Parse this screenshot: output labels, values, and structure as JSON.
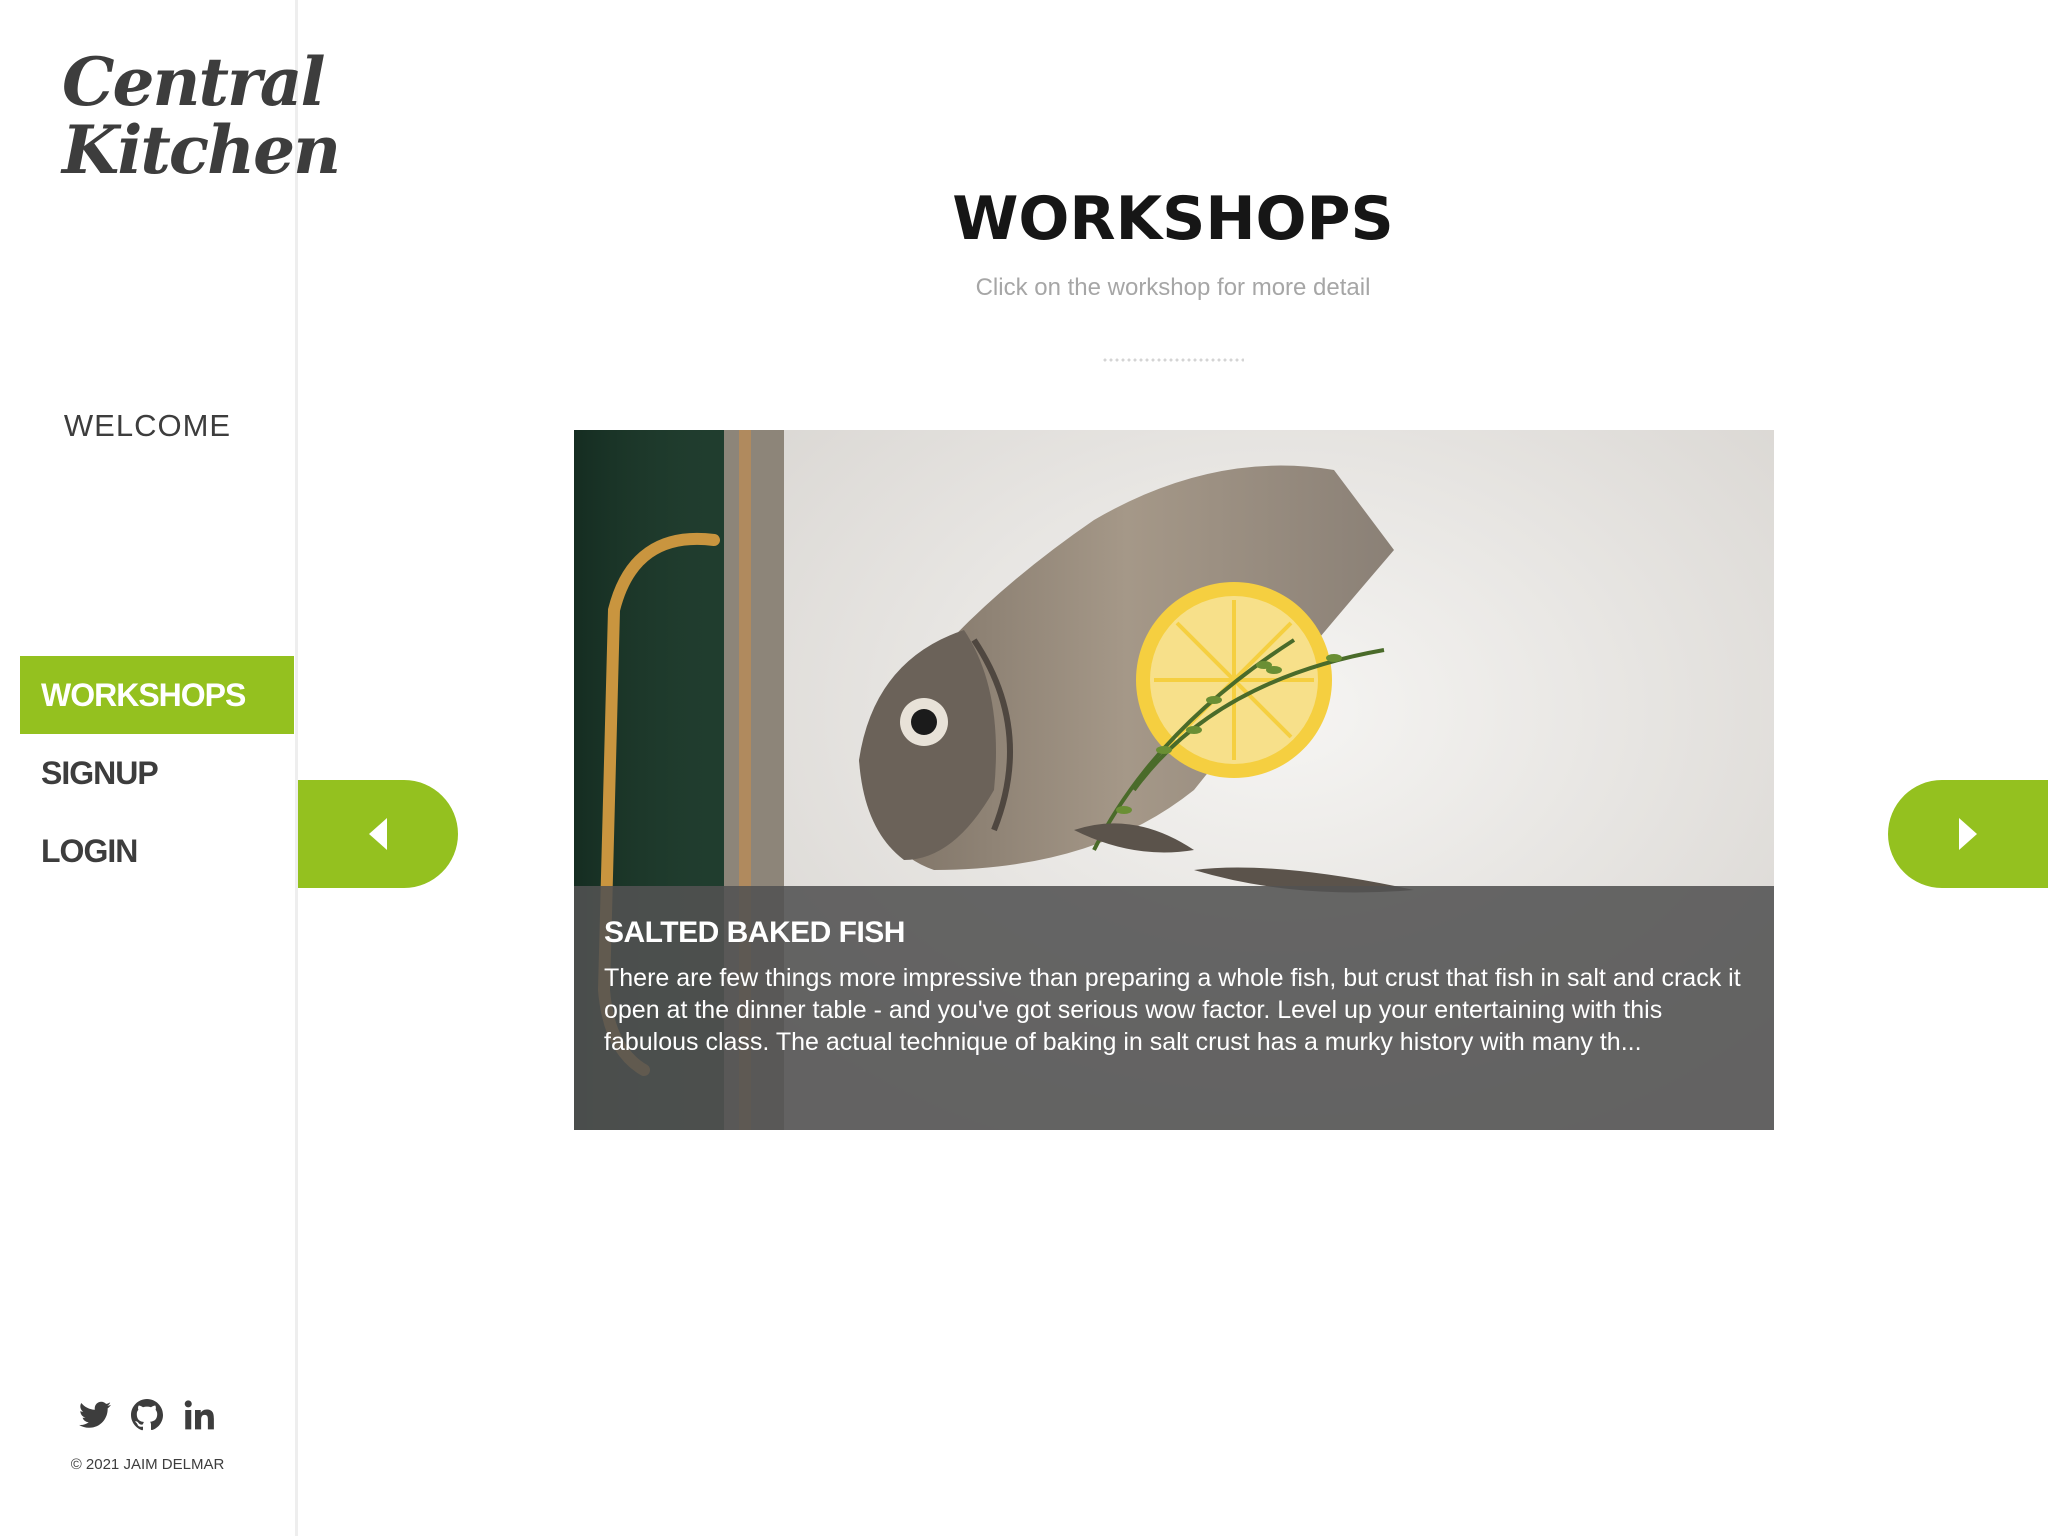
{
  "sidebar": {
    "logo_line1": "Central",
    "logo_line2": "Kitchen",
    "welcome": "WELCOME",
    "nav": [
      {
        "label": "WORKSHOPS",
        "active": true
      },
      {
        "label": "SIGNUP",
        "active": false
      },
      {
        "label": "LOGIN",
        "active": false
      }
    ],
    "social_icons": [
      "twitter-icon",
      "github-icon",
      "linkedin-icon"
    ],
    "copyright": "© 2021 JAIM DELMAR"
  },
  "main": {
    "title": "WORKSHOPS",
    "subtitle": "Click on the workshop for more detail",
    "workshop": {
      "title": "SALTED BAKED FISH",
      "description": "There are few things more impressive than preparing a whole fish, but crust that fish in salt and crack it open at the dinner table - and you've got serious wow factor. Level up your entertaining with this fabulous class. The actual technique of baking in salt crust has a murky history with many th..."
    }
  },
  "colors": {
    "accent": "#94c11f",
    "text_dark": "#3d3d3d",
    "subtitle": "#a6a6a6"
  }
}
